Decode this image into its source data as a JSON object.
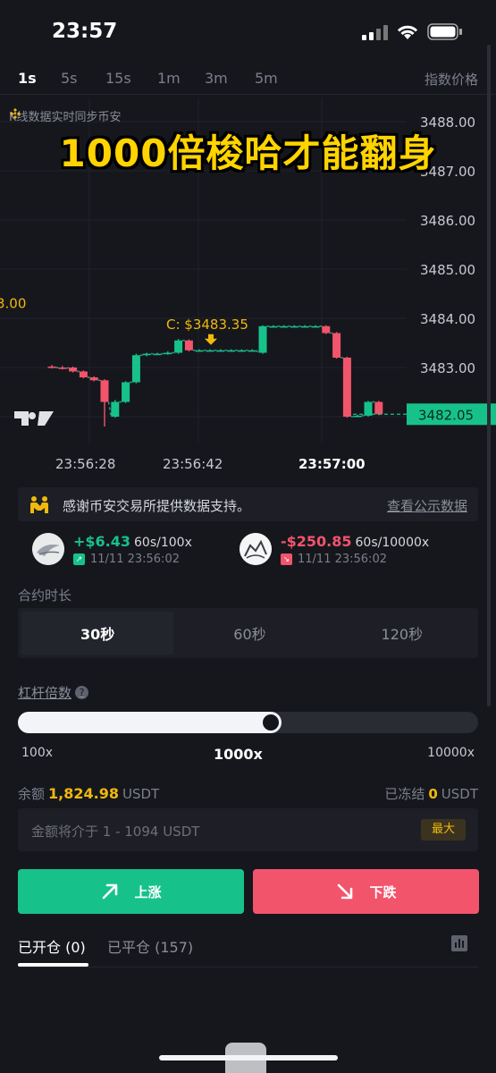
{
  "status": {
    "time": "23:57"
  },
  "tabs": [
    {
      "label": "1s",
      "active": true
    },
    {
      "label": "5s",
      "active": false
    },
    {
      "label": "15s",
      "active": false
    },
    {
      "label": "1m",
      "active": false
    },
    {
      "label": "3m",
      "active": false
    },
    {
      "label": "5m",
      "active": false
    }
  ],
  "index_price_label": "指数价格",
  "chart_note": "K线数据实时同步币安",
  "overlay_title": "1000倍梭哈才能翻身",
  "chart_data": {
    "type": "candlestick",
    "y_ticks": [
      "3488.00",
      "3487.00",
      "3486.00",
      "3485.00",
      "3484.00",
      "3483.00"
    ],
    "ylim": [
      3481.6,
      3488.2
    ],
    "x_ticks": [
      "23:56:28",
      "23:56:42",
      "23:57:00"
    ],
    "current_price": "3482.05",
    "left_edge_label": "3.00",
    "callout": "C: $3483.35",
    "candles": [
      {
        "o": 3483.02,
        "c": 3483.0,
        "h": 3483.05,
        "l": 3482.98
      },
      {
        "o": 3483.0,
        "c": 3482.98,
        "h": 3483.03,
        "l": 3482.96
      },
      {
        "o": 3483.0,
        "c": 3482.92,
        "h": 3483.02,
        "l": 3482.9
      },
      {
        "o": 3482.92,
        "c": 3482.8,
        "h": 3482.94,
        "l": 3482.78
      },
      {
        "o": 3482.8,
        "c": 3482.74,
        "h": 3482.82,
        "l": 3482.72
      },
      {
        "o": 3482.74,
        "c": 3482.3,
        "h": 3482.76,
        "l": 3481.8
      },
      {
        "o": 3482.0,
        "c": 3482.3,
        "h": 3482.34,
        "l": 3481.98
      },
      {
        "o": 3482.3,
        "c": 3482.7,
        "h": 3482.72,
        "l": 3482.28
      },
      {
        "o": 3482.7,
        "c": 3483.25,
        "h": 3483.28,
        "l": 3482.68
      },
      {
        "o": 3483.25,
        "c": 3483.28,
        "h": 3483.3,
        "l": 3483.23
      },
      {
        "o": 3483.28,
        "c": 3483.28,
        "h": 3483.3,
        "l": 3483.26
      },
      {
        "o": 3483.28,
        "c": 3483.3,
        "h": 3483.33,
        "l": 3483.26
      },
      {
        "o": 3483.3,
        "c": 3483.55,
        "h": 3483.58,
        "l": 3483.28
      },
      {
        "o": 3483.55,
        "c": 3483.35,
        "h": 3483.57,
        "l": 3483.33
      },
      {
        "o": 3483.35,
        "c": 3483.35,
        "h": 3483.37,
        "l": 3483.33
      },
      {
        "o": 3483.35,
        "c": 3483.35,
        "h": 3483.37,
        "l": 3483.33
      },
      {
        "o": 3483.35,
        "c": 3483.35,
        "h": 3483.37,
        "l": 3483.33
      },
      {
        "o": 3483.35,
        "c": 3483.35,
        "h": 3483.37,
        "l": 3483.33
      },
      {
        "o": 3483.35,
        "c": 3483.35,
        "h": 3483.37,
        "l": 3483.33
      },
      {
        "o": 3483.35,
        "c": 3483.35,
        "h": 3483.37,
        "l": 3483.33
      },
      {
        "o": 3483.3,
        "c": 3483.84,
        "h": 3483.86,
        "l": 3483.28
      },
      {
        "o": 3483.84,
        "c": 3483.84,
        "h": 3483.86,
        "l": 3483.82
      },
      {
        "o": 3483.84,
        "c": 3483.84,
        "h": 3483.86,
        "l": 3483.82
      },
      {
        "o": 3483.84,
        "c": 3483.84,
        "h": 3483.86,
        "l": 3483.82
      },
      {
        "o": 3483.84,
        "c": 3483.84,
        "h": 3483.86,
        "l": 3483.82
      },
      {
        "o": 3483.84,
        "c": 3483.84,
        "h": 3483.86,
        "l": 3483.82
      },
      {
        "o": 3483.84,
        "c": 3483.7,
        "h": 3483.86,
        "l": 3483.68
      },
      {
        "o": 3483.7,
        "c": 3483.2,
        "h": 3483.72,
        "l": 3483.18
      },
      {
        "o": 3483.2,
        "c": 3482.0,
        "h": 3483.22,
        "l": 3481.98
      },
      {
        "o": 3482.0,
        "c": 3482.02,
        "h": 3482.04,
        "l": 3481.99
      },
      {
        "o": 3482.02,
        "c": 3482.3,
        "h": 3482.32,
        "l": 3482.0
      },
      {
        "o": 3482.3,
        "c": 3482.05,
        "h": 3482.32,
        "l": 3482.03
      }
    ]
  },
  "banner": {
    "text": "感谢币安交易所提供数据支持。",
    "link": "查看公示数据"
  },
  "trades": [
    {
      "pnl": "+$6.43",
      "info": "60s/100x",
      "time": "11/11 23:56:02",
      "direction": "up"
    },
    {
      "pnl": "-$250.85",
      "info": "60s/10000x",
      "time": "11/11 23:56:02",
      "direction": "down"
    }
  ],
  "duration": {
    "label": "合约时长",
    "options": [
      {
        "label": "30秒",
        "active": true
      },
      {
        "label": "60秒",
        "active": false
      },
      {
        "label": "120秒",
        "active": false
      }
    ]
  },
  "leverage": {
    "label": "杠杆倍数",
    "help": "?",
    "level": 0.5,
    "ticks": [
      "100x",
      "1000x",
      "10000x"
    ]
  },
  "balance": {
    "label": "余额",
    "value": "1,824.98",
    "unit": "USDT"
  },
  "frozen": {
    "label": "已冻结",
    "value": "0",
    "unit": "USDT"
  },
  "amount": {
    "placeholder": "金额将介于 1 - 1094 USDT",
    "max": "最大"
  },
  "buttons": {
    "up": "上涨",
    "down": "下跌"
  },
  "positions": {
    "open": "已开仓 (0)",
    "closed": "已平仓 (157)"
  },
  "colors": {
    "up": "#17c28a",
    "down": "#f2546c",
    "accent": "#f0b90b"
  }
}
